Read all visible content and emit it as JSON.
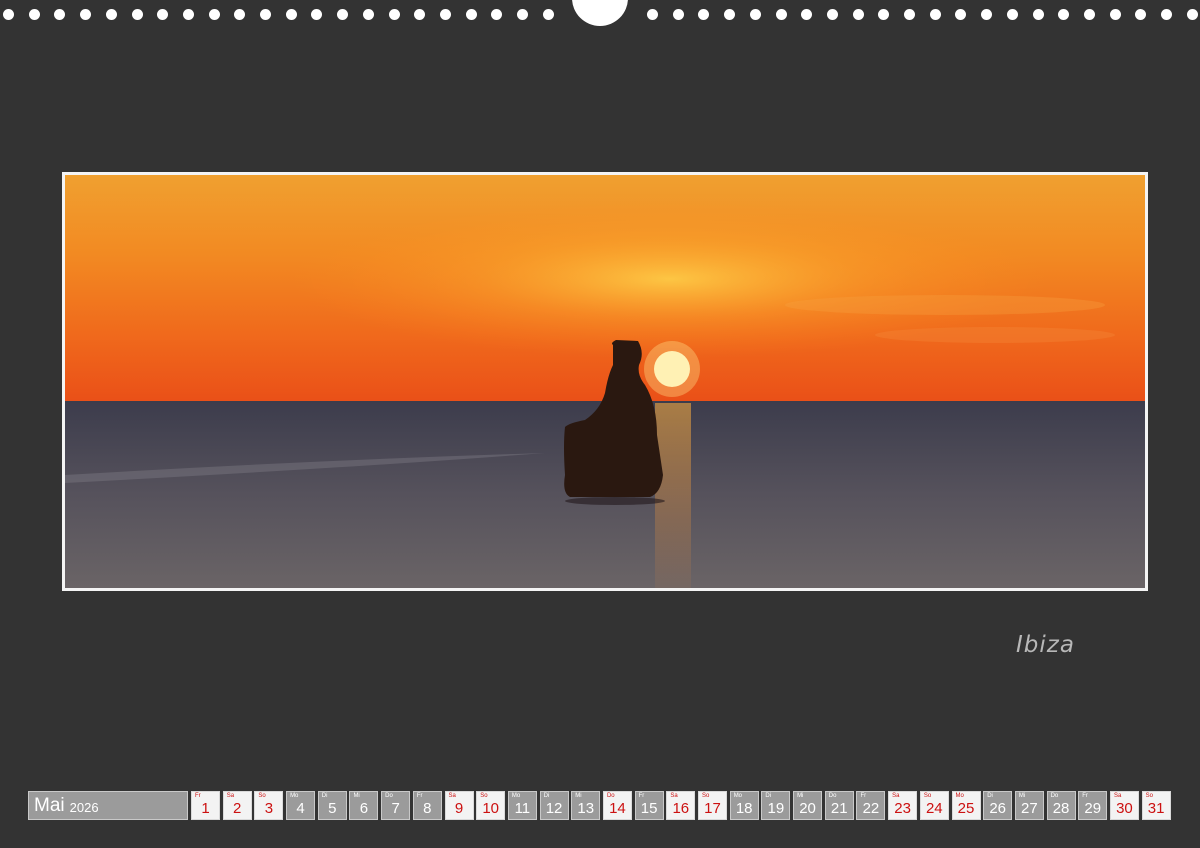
{
  "calendar": {
    "month": "Mai",
    "year": "2026",
    "days": [
      {
        "wd": "Fr",
        "num": "1",
        "red": true
      },
      {
        "wd": "Sa",
        "num": "2",
        "red": true
      },
      {
        "wd": "So",
        "num": "3",
        "red": true
      },
      {
        "wd": "Mo",
        "num": "4",
        "red": false
      },
      {
        "wd": "Di",
        "num": "5",
        "red": false
      },
      {
        "wd": "Mi",
        "num": "6",
        "red": false
      },
      {
        "wd": "Do",
        "num": "7",
        "red": false
      },
      {
        "wd": "Fr",
        "num": "8",
        "red": false
      },
      {
        "wd": "Sa",
        "num": "9",
        "red": true
      },
      {
        "wd": "So",
        "num": "10",
        "red": true
      },
      {
        "wd": "Mo",
        "num": "11",
        "red": false
      },
      {
        "wd": "Di",
        "num": "12",
        "red": false
      },
      {
        "wd": "Mi",
        "num": "13",
        "red": false
      },
      {
        "wd": "Do",
        "num": "14",
        "red": true
      },
      {
        "wd": "Fr",
        "num": "15",
        "red": false
      },
      {
        "wd": "Sa",
        "num": "16",
        "red": true
      },
      {
        "wd": "So",
        "num": "17",
        "red": true
      },
      {
        "wd": "Mo",
        "num": "18",
        "red": false
      },
      {
        "wd": "Di",
        "num": "19",
        "red": false
      },
      {
        "wd": "Mi",
        "num": "20",
        "red": false
      },
      {
        "wd": "Do",
        "num": "21",
        "red": false
      },
      {
        "wd": "Fr",
        "num": "22",
        "red": false
      },
      {
        "wd": "Sa",
        "num": "23",
        "red": true
      },
      {
        "wd": "So",
        "num": "24",
        "red": true
      },
      {
        "wd": "Mo",
        "num": "25",
        "red": true
      },
      {
        "wd": "Di",
        "num": "26",
        "red": false
      },
      {
        "wd": "Mi",
        "num": "27",
        "red": false
      },
      {
        "wd": "Do",
        "num": "28",
        "red": false
      },
      {
        "wd": "Fr",
        "num": "29",
        "red": false
      },
      {
        "wd": "Sa",
        "num": "30",
        "red": true
      },
      {
        "wd": "So",
        "num": "31",
        "red": true
      }
    ]
  },
  "photo": {
    "caption": "Ibiza",
    "icon": "sunset-sea-rock-photo"
  },
  "colors": {
    "background": "#333333",
    "day_cell": "#9b9b9b",
    "weekend_cell": "#f3f3f3",
    "weekend_text": "#cc1111"
  }
}
